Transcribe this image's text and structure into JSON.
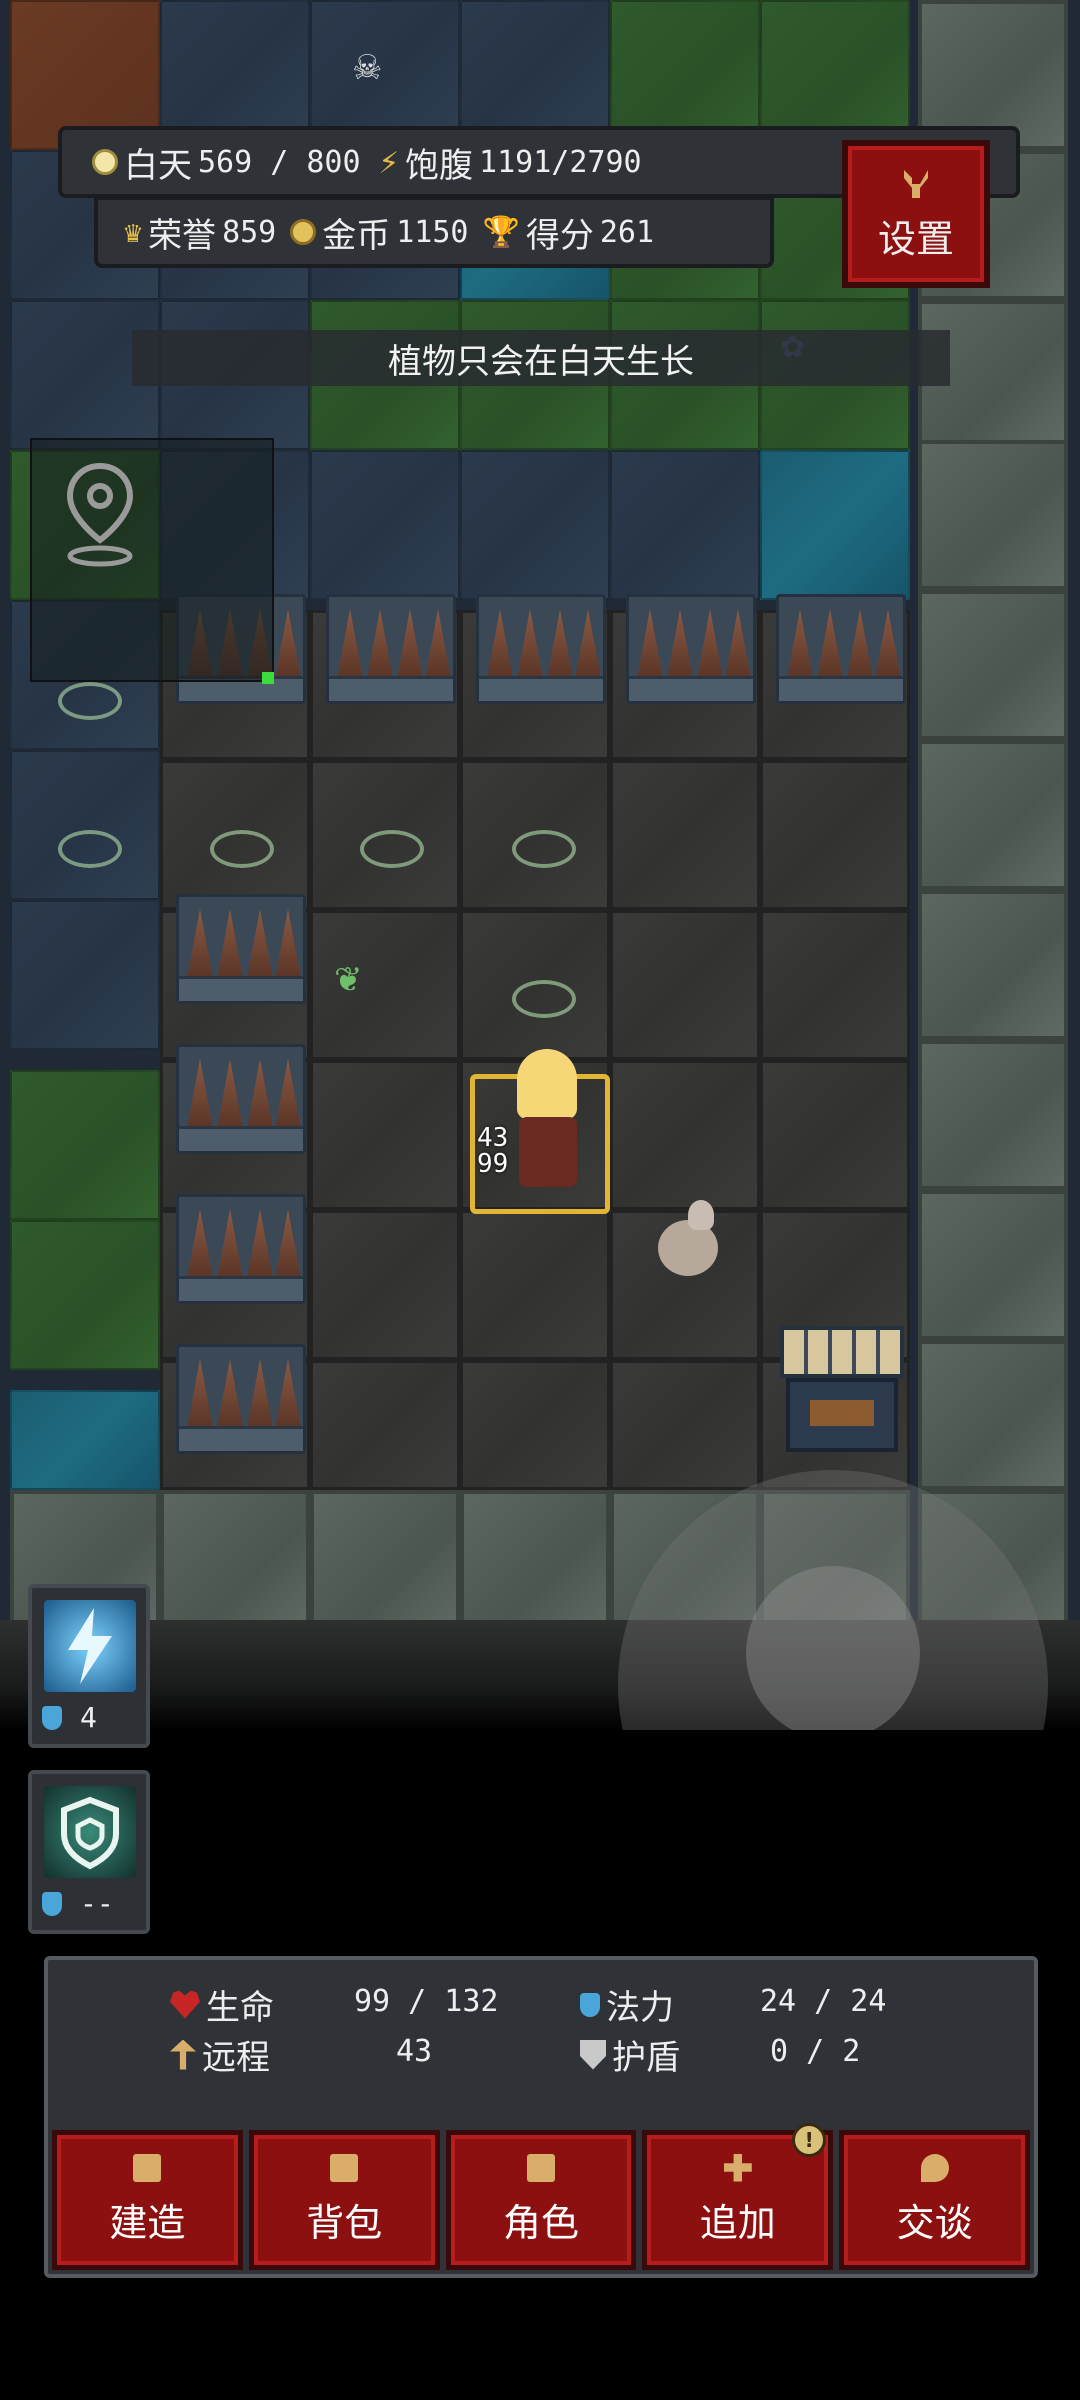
{
  "hud": {
    "day": {
      "label": "白天",
      "value": "569 / 800"
    },
    "hunger": {
      "label": "饱腹",
      "value": "1191/2790"
    },
    "honor": {
      "label": "荣誉",
      "value": "859"
    },
    "gold": {
      "label": "金币",
      "value": "1150"
    },
    "score": {
      "label": "得分",
      "value": "261"
    },
    "settings_label": "设置"
  },
  "toast": "植物只会在白天生长",
  "player": {
    "attack": "43",
    "hp": "99"
  },
  "quickslots": [
    {
      "icon": "lightning-spell-icon",
      "count": "4"
    },
    {
      "icon": "shield-rune-icon",
      "count": "--"
    }
  ],
  "stats": {
    "life": {
      "label": "生命",
      "value": "99 / 132"
    },
    "mana": {
      "label": "法力",
      "value": "24 / 24"
    },
    "ranged": {
      "label": "远程",
      "value": "43"
    },
    "shield": {
      "label": "护盾",
      "value": "0 / 2"
    }
  },
  "nav": [
    {
      "label": "建造",
      "icon": "hammer-icon"
    },
    {
      "label": "背包",
      "icon": "bag-icon"
    },
    {
      "label": "角色",
      "icon": "character-icon"
    },
    {
      "label": "追加",
      "icon": "plus-icon",
      "badge": "!"
    },
    {
      "label": "交谈",
      "icon": "chat-icon"
    }
  ],
  "colors": {
    "accent_red": "#8d1010",
    "gold": "#e2c25c",
    "panel": "#2f3338"
  }
}
